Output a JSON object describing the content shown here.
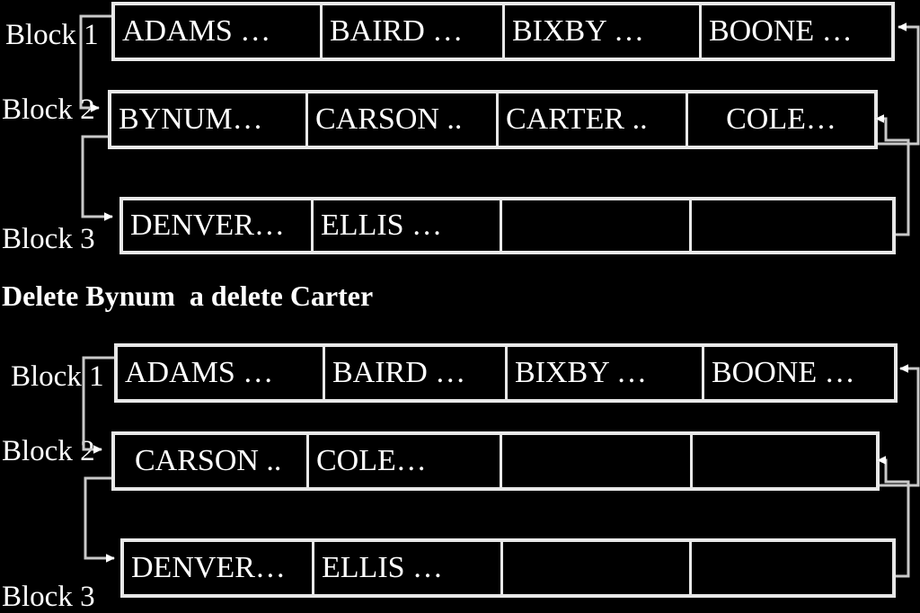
{
  "caption": "Delete Bynum  a delete Carter",
  "colors": {
    "background": "#000000",
    "foreground": "#ffffff",
    "border": "#e8e8e8",
    "connector": "#c9c9c9"
  },
  "diagrams": [
    {
      "id": "before-delete",
      "blocks": [
        {
          "label": "Block 1",
          "cells": [
            "ADAMS …",
            "BAIRD …",
            "BIXBY …",
            "BOONE …"
          ]
        },
        {
          "label": "Block 2",
          "cells": [
            "BYNUM…",
            "CARSON ..",
            "CARTER ..",
            "COLE…"
          ]
        },
        {
          "label": "Block 3",
          "cells": [
            "DENVER…",
            "ELLIS …",
            "",
            ""
          ]
        }
      ]
    },
    {
      "id": "after-delete",
      "blocks": [
        {
          "label": "Block 1",
          "cells": [
            "ADAMS …",
            "BAIRD …",
            "BIXBY …",
            "BOONE …"
          ]
        },
        {
          "label": "Block 2",
          "cells": [
            "CARSON ..",
            "COLE…",
            "",
            ""
          ]
        },
        {
          "label": "Block 3",
          "cells": [
            "DENVER…",
            "ELLIS …",
            "",
            ""
          ]
        }
      ]
    }
  ]
}
